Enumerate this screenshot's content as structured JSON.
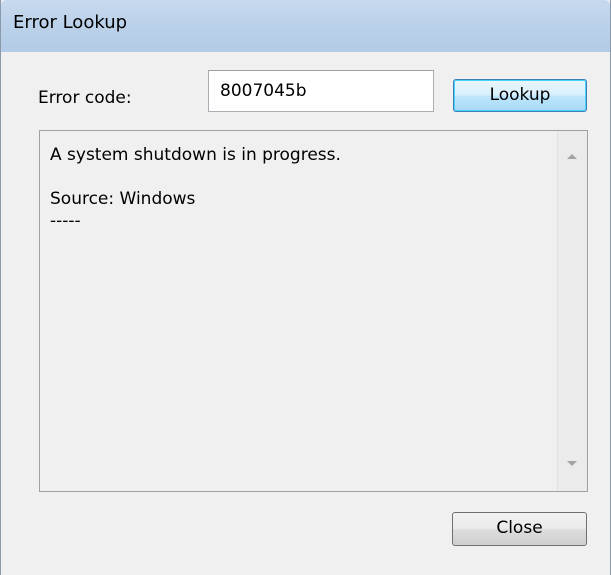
{
  "window": {
    "title": "Error Lookup"
  },
  "form": {
    "error_code_label": "Error code:",
    "error_code_value": "8007045b",
    "lookup_label": "Lookup"
  },
  "result": {
    "lines": [
      "A system shutdown is in progress.",
      "",
      "Source: Windows",
      "-----"
    ]
  },
  "footer": {
    "close_label": "Close"
  },
  "colors": {
    "titlebar": "#bcd2ea",
    "dialog_background": "#f0f0f0",
    "default_button_border": "#3c7fb1"
  },
  "icons": {
    "scroll_up": "scroll-up-arrow-icon",
    "scroll_down": "scroll-down-arrow-icon"
  }
}
